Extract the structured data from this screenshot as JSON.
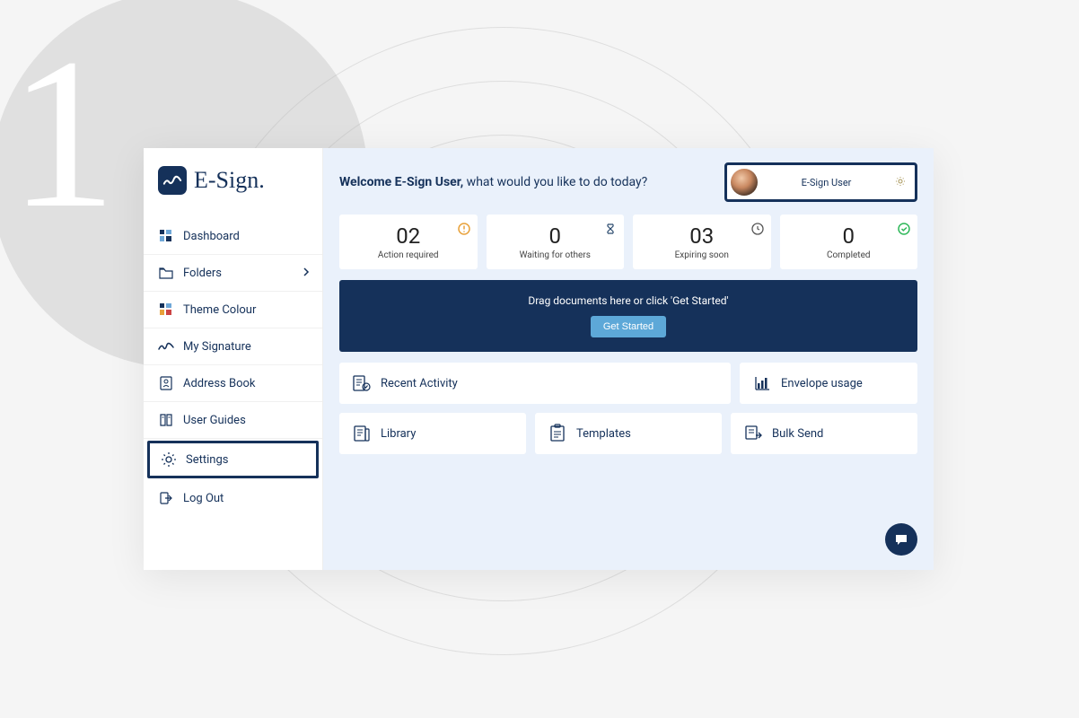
{
  "brand": {
    "name": "E-Sign."
  },
  "sidebar": {
    "items": [
      {
        "label": "Dashboard"
      },
      {
        "label": "Folders"
      },
      {
        "label": "Theme Colour"
      },
      {
        "label": "My Signature"
      },
      {
        "label": "Address Book"
      },
      {
        "label": "User Guides"
      },
      {
        "label": "Settings"
      },
      {
        "label": "Log Out"
      }
    ]
  },
  "header": {
    "welcome_bold": "Welcome E-Sign User,",
    "welcome_rest": " what would you like to do today?",
    "user_name": "E-Sign User"
  },
  "stats": [
    {
      "value": "02",
      "label": "Action required",
      "icon_color": "#e8a13a"
    },
    {
      "value": "0",
      "label": "Waiting for others",
      "icon_color": "#2b4a6e"
    },
    {
      "value": "03",
      "label": "Expiring soon",
      "icon_color": "#555"
    },
    {
      "value": "0",
      "label": "Completed",
      "icon_color": "#2fb85a"
    }
  ],
  "dropzone": {
    "text": "Drag documents here or click 'Get Started'",
    "button": "Get Started"
  },
  "cards": {
    "recent": "Recent Activity",
    "envelope": "Envelope usage",
    "library": "Library",
    "templates": "Templates",
    "bulk": "Bulk Send"
  }
}
